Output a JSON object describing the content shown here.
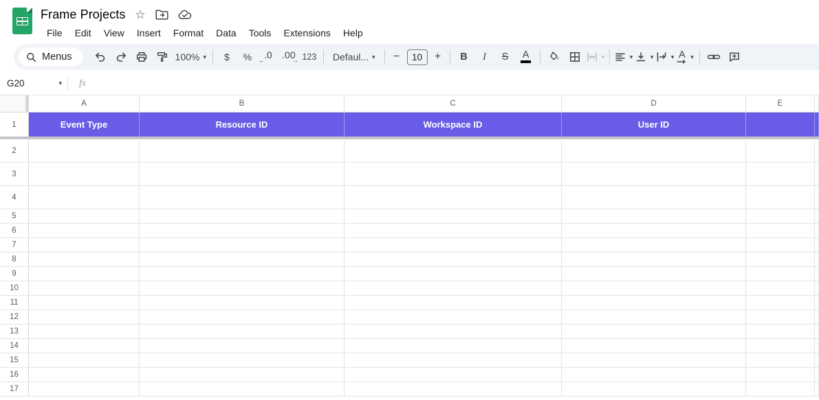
{
  "titlebar": {
    "title": "Frame Projects",
    "menus": [
      "File",
      "Edit",
      "View",
      "Insert",
      "Format",
      "Data",
      "Tools",
      "Extensions",
      "Help"
    ]
  },
  "toolbar": {
    "search_label": "Menus",
    "zoom_value": "100%",
    "currency_label": "$",
    "percent_label": "%",
    "decrease_decimal_label": ".0",
    "increase_decimal_label": ".00",
    "number_format_label": "123",
    "font_value": "Defaul...",
    "minus_label": "−",
    "font_size_value": "10",
    "plus_label": "+",
    "bold_label": "B",
    "italic_label": "I",
    "strikethrough_label": "S",
    "text_color_label": "A",
    "text_rotation_label": "A"
  },
  "formula_bar": {
    "name_box_value": "G20",
    "fx_label": "fx",
    "formula_value": ""
  },
  "sheet": {
    "columns": [
      "A",
      "B",
      "C",
      "D",
      "E"
    ],
    "frozen_row": {
      "number": "1",
      "cells": [
        "Event Type",
        "Resource ID",
        "Workspace ID",
        "User ID",
        ""
      ]
    },
    "row_numbers": [
      "2",
      "3",
      "4",
      "5",
      "6",
      "7",
      "8",
      "9",
      "10",
      "11",
      "12",
      "13",
      "14",
      "15",
      "16",
      "17"
    ],
    "colors": {
      "frozen_row_fill": "#695ce7",
      "frozen_row_text": "#ffffff",
      "sheets_green": "#23a566"
    }
  }
}
